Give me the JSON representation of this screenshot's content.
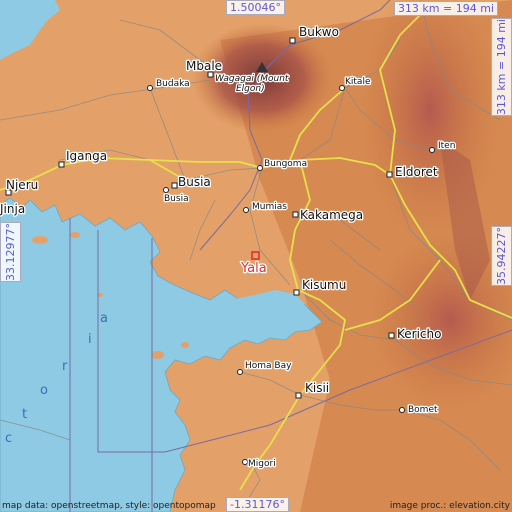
{
  "place": {
    "name": "Yala",
    "color": "#e03030"
  },
  "scale": {
    "text": "313 km = 194 mi"
  },
  "coordinates": {
    "north": "1.50046°",
    "south": "-1.31176°",
    "west": "33.12977°",
    "east": "35.94227°"
  },
  "water_label": "V i c t o r i a",
  "water_letters": [
    "c",
    "t",
    "o",
    "r",
    "i",
    "a"
  ],
  "cities": [
    {
      "name": "Bukwo",
      "size": "med",
      "icon": "city-square"
    },
    {
      "name": "Mbale",
      "size": "med",
      "icon": "city-square"
    },
    {
      "name": "Budaka",
      "size": "small",
      "icon": "town-circle"
    },
    {
      "name": "Wagagai (Mount Elgon)",
      "line1": "Wagagai (Mount",
      "line2": "Elgon)",
      "size": "peak",
      "icon": "peak-triangle"
    },
    {
      "name": "Kitale",
      "size": "small",
      "icon": "town-circle"
    },
    {
      "name": "Iten",
      "size": "small",
      "icon": "town-circle"
    },
    {
      "name": "Iganga",
      "size": "med",
      "icon": "city-square"
    },
    {
      "name": "Bungoma",
      "size": "small",
      "icon": "town-circle"
    },
    {
      "name": "Eldoret",
      "size": "med",
      "icon": "city-square"
    },
    {
      "name": "Njeru",
      "size": "med",
      "icon": "city-square"
    },
    {
      "name": "Jinja",
      "size": "med",
      "icon": "city-square"
    },
    {
      "name": "Busia",
      "size": "med",
      "icon": "city-square"
    },
    {
      "name": "Busia",
      "size": "small",
      "icon": "town-circle"
    },
    {
      "name": "Mumias",
      "size": "small",
      "icon": "town-circle"
    },
    {
      "name": "Kakamega",
      "size": "med",
      "icon": "city-square"
    },
    {
      "name": "Kisumu",
      "size": "med",
      "icon": "city-square"
    },
    {
      "name": "Kericho",
      "size": "med",
      "icon": "city-square"
    },
    {
      "name": "Homa Bay",
      "size": "small",
      "icon": "town-circle"
    },
    {
      "name": "Kisii",
      "size": "med",
      "icon": "city-square"
    },
    {
      "name": "Bomet",
      "size": "small",
      "icon": "town-circle"
    },
    {
      "name": "Migori",
      "size": "small",
      "icon": "town-circle"
    }
  ],
  "attribution": {
    "left": "map data: openstreetmap, style: opentopomap",
    "right": "image proc.: elevation.city"
  },
  "colors": {
    "water": "#8ecae3",
    "terrain_low": "#e5a46a",
    "terrain_mid": "#c9763e",
    "terrain_high": "#9c4a3a",
    "main_road": "#e6e04a",
    "border": "#7a6aa0",
    "coord_text": "#5a5ad0"
  }
}
